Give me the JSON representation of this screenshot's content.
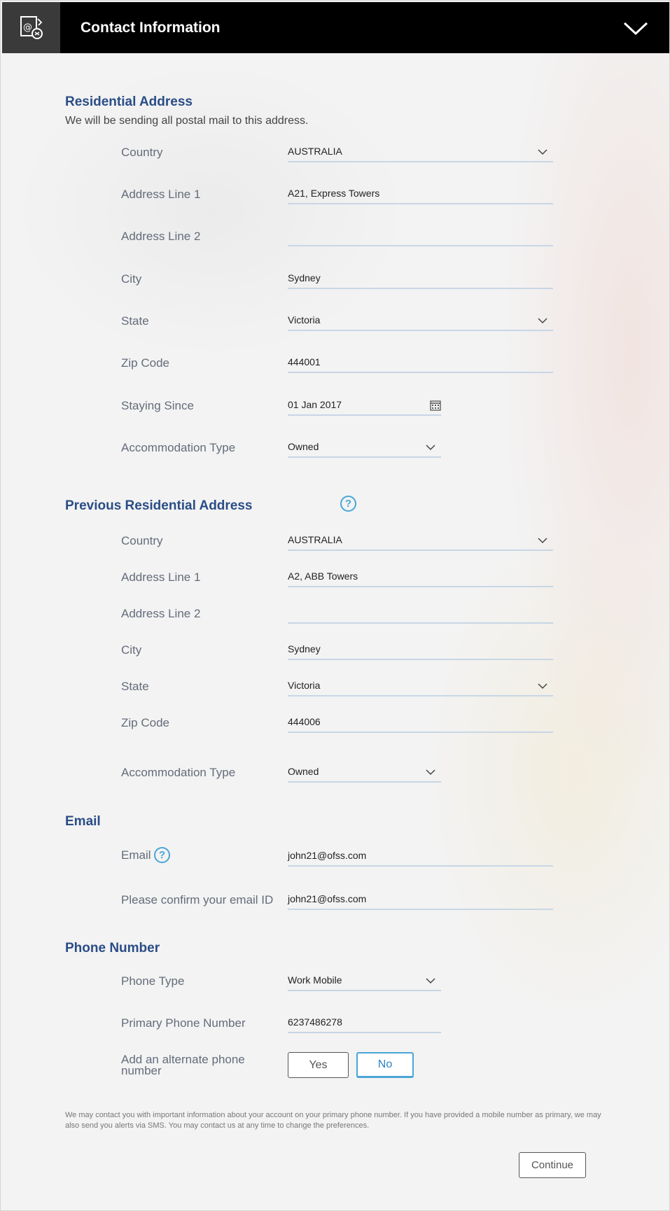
{
  "header": {
    "title": "Contact Information",
    "icon": "contact-mail-icon",
    "toggle_icon": "chevron-down-icon"
  },
  "residential": {
    "title": "Residential Address",
    "subtitle": "We will be sending all postal mail to this address.",
    "country": {
      "label": "Country",
      "value": "AUSTRALIA"
    },
    "address1": {
      "label": "Address Line 1",
      "value": "A21, Express Towers"
    },
    "address2": {
      "label": "Address Line 2",
      "value": ""
    },
    "city": {
      "label": "City",
      "value": "Sydney"
    },
    "state": {
      "label": "State",
      "value": "Victoria"
    },
    "zip": {
      "label": "Zip Code",
      "value": "444001"
    },
    "staying_since": {
      "label": "Staying Since",
      "value": "01 Jan 2017"
    },
    "accommodation": {
      "label": "Accommodation Type",
      "value": "Owned"
    }
  },
  "previous": {
    "title": "Previous Residential Address",
    "help": "?",
    "country": {
      "label": "Country",
      "value": "AUSTRALIA"
    },
    "address1": {
      "label": "Address Line 1",
      "value": "A2, ABB Towers"
    },
    "address2": {
      "label": "Address Line 2",
      "value": ""
    },
    "city": {
      "label": "City",
      "value": "Sydney"
    },
    "state": {
      "label": "State",
      "value": "Victoria"
    },
    "zip": {
      "label": "Zip Code",
      "value": "444006"
    },
    "accommodation": {
      "label": "Accommodation Type",
      "value": "Owned"
    }
  },
  "email": {
    "title": "Email",
    "email": {
      "label": "Email",
      "value": "john21@ofss.com",
      "help": "?"
    },
    "confirm": {
      "label": "Please confirm your email ID",
      "value": "john21@ofss.com"
    }
  },
  "phone": {
    "title": "Phone Number",
    "type": {
      "label": "Phone Type",
      "value": "Work Mobile"
    },
    "primary": {
      "label": "Primary Phone Number",
      "value": "6237486278"
    },
    "alternate": {
      "label_line1": "Add an alternate phone",
      "label_line2": "number",
      "yes": "Yes",
      "no": "No",
      "selected": "No"
    }
  },
  "disclaimer": "We may contact you with important information about your account on your primary phone number. If you have provided a mobile number as primary, we may also send you alerts via SMS. You may contact us at any time to change the preferences.",
  "continue_label": "Continue",
  "colors": {
    "header_bg": "#000000",
    "icon_box_bg": "#3a3a3a",
    "section_title": "#2a4d86",
    "accent": "#4aa5d8"
  }
}
